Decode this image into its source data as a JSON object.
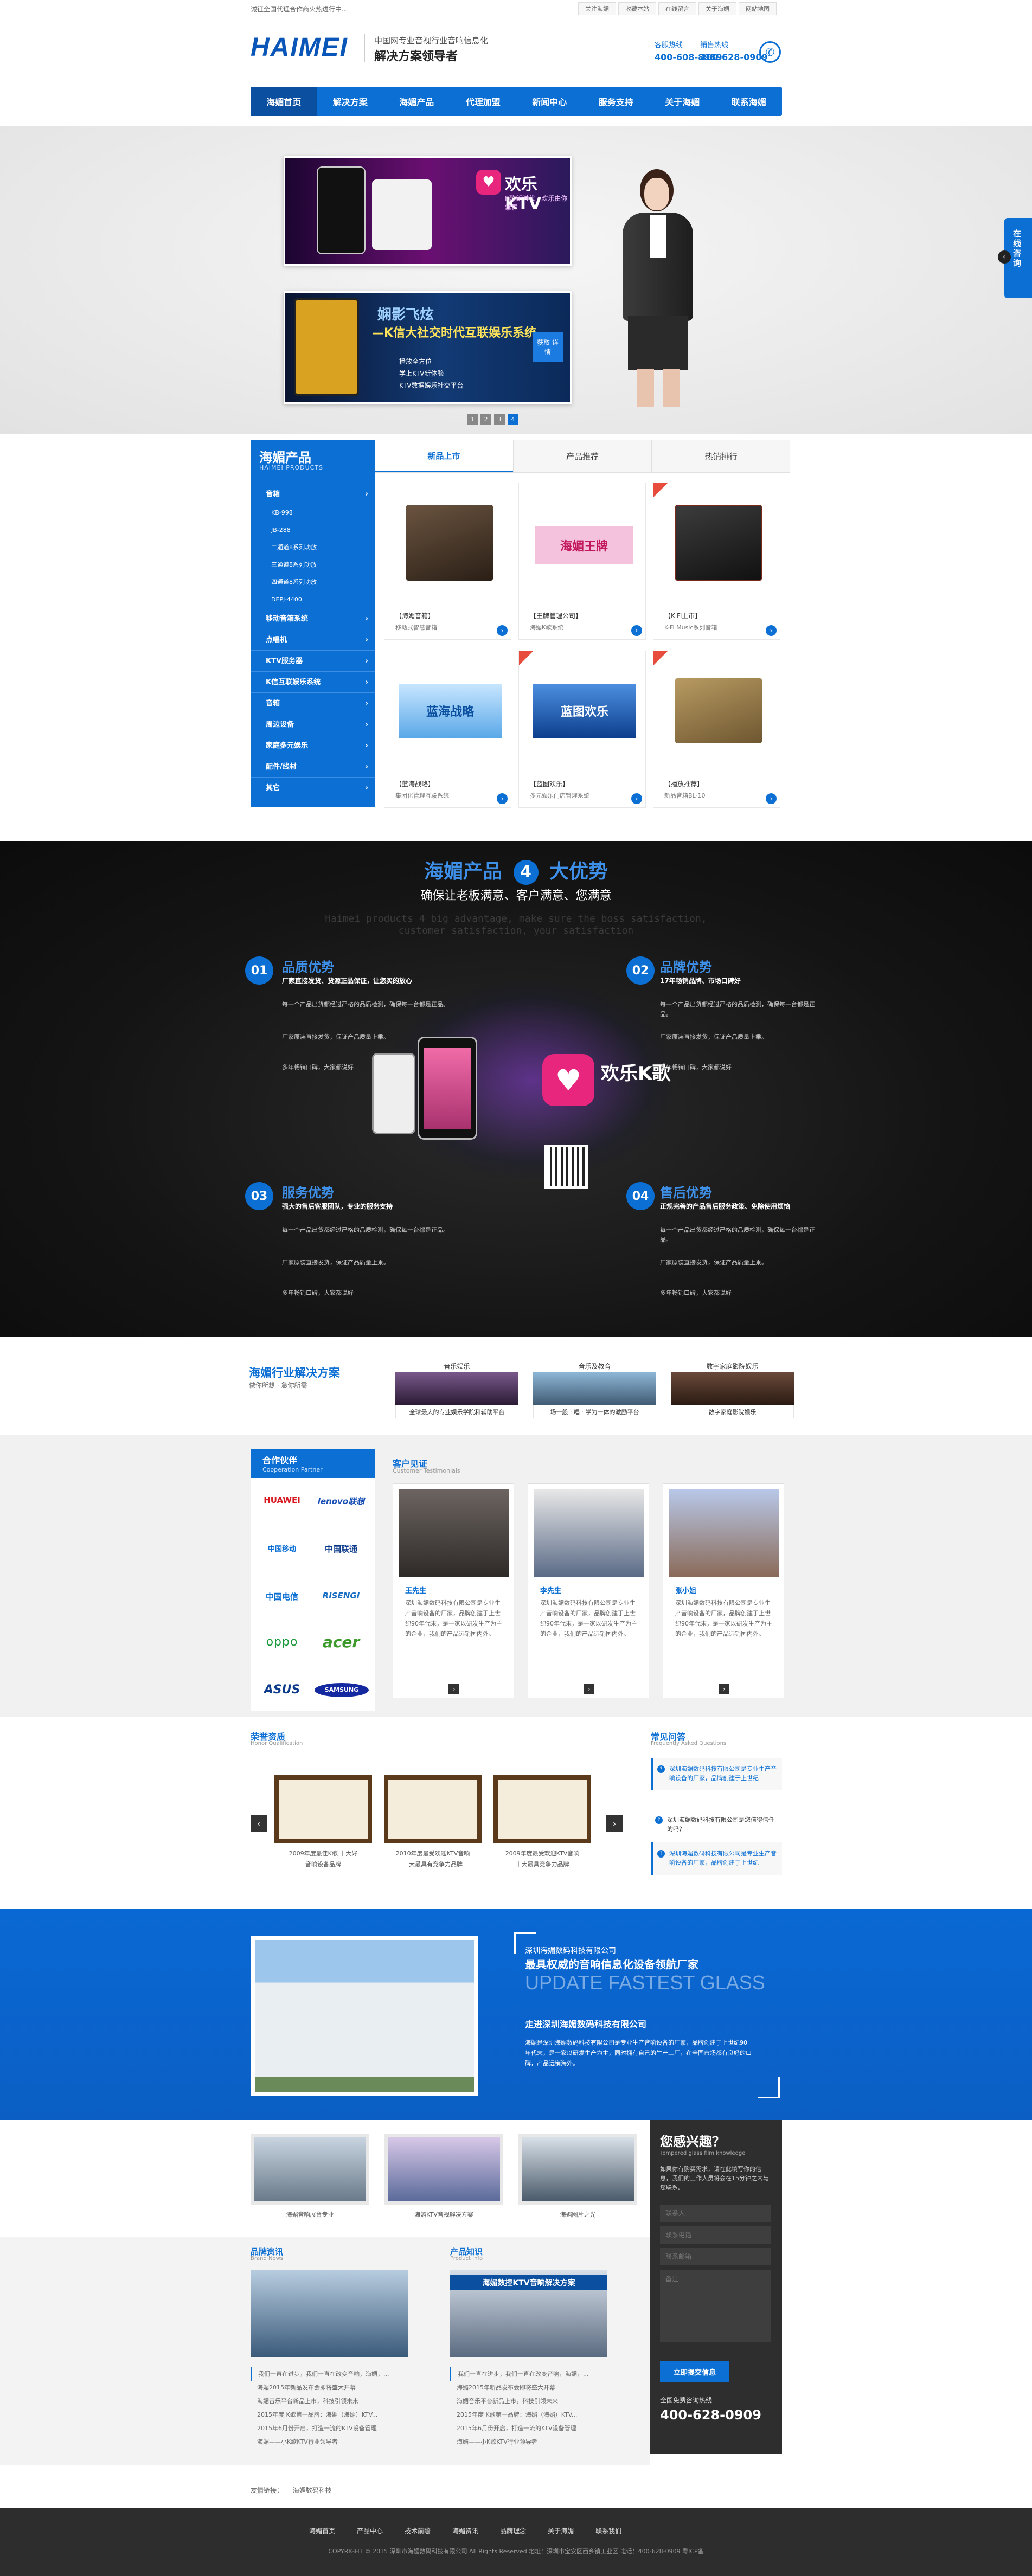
{
  "colors": {
    "accent": "#0b6fd3",
    "navy": "#0a4fa0",
    "dark": "#171717",
    "footer": "#2d2d2d"
  },
  "topbar": {
    "welcome": "诚征全国代理合作商火热进行中...",
    "links": [
      "关注海媚",
      "收藏本站",
      "在线留言",
      "关于海媚",
      "网站地图"
    ]
  },
  "header": {
    "logo": "HAIMEI",
    "slogan_line1": "中国网专业音视行业音响信息化",
    "slogan_line2": "解决方案领导者",
    "hotline_label1": "客服热线",
    "hotline_label2": "销售热线",
    "hotline1": "400-608-8989",
    "hotline2": "400-628-0909",
    "phone_icon": "phone-icon"
  },
  "nav": {
    "items": [
      "海媚首页",
      "解决方案",
      "海媚产品",
      "代理加盟",
      "新闻中心",
      "服务支持",
      "关于海媚",
      "联系海媚"
    ]
  },
  "banner": {
    "ad1_title": "欢乐KTV",
    "ad1_sub": "K歌新时代 · 欢乐由你掌握",
    "ad2_line1": "娴影飞炫",
    "ad2_line2": "—K信大社交时代互联娱乐系统",
    "ad2_b1": "播放全方位",
    "ad2_b2": "学上KTV新体验",
    "ad2_b3": "KTV数据娱乐社交平台",
    "ad2_btn": "获取 详情",
    "dots": [
      "1",
      "2",
      "3",
      "4"
    ],
    "active_dot": 3
  },
  "float_service": {
    "label": "在线咨询"
  },
  "products": {
    "title": "海媚产品",
    "subtitle": "HAIMEI PRODUCTS",
    "cats": [
      {
        "label": "音箱",
        "bold": true
      },
      {
        "label": "KB-998",
        "bold": false
      },
      {
        "label": "JB-288",
        "bold": false
      },
      {
        "label": "二通道8系列功放",
        "bold": false
      },
      {
        "label": "三通道8系列功放",
        "bold": false
      },
      {
        "label": "四通道8系列功放",
        "bold": false
      },
      {
        "label": "DEPJ-4400",
        "bold": false
      },
      {
        "label": "移动音箱系统",
        "bold": true
      },
      {
        "label": "点唱机",
        "bold": true
      },
      {
        "label": "KTV服务器",
        "bold": true
      },
      {
        "label": "K信互联娱乐系统",
        "bold": true
      },
      {
        "label": "音箱",
        "bold": true
      },
      {
        "label": "周边设备",
        "bold": true
      },
      {
        "label": "家庭多元娱乐",
        "bold": true
      },
      {
        "label": "配件/线材",
        "bold": true
      },
      {
        "label": "其它",
        "bold": true
      }
    ],
    "tabs": [
      "新品上市",
      "产品推荐",
      "热销排行"
    ],
    "active_tab": 0,
    "items": [
      {
        "name": "【海媚音箱】",
        "desc": "移动式智慧音箱",
        "img": "speaker-brown",
        "hot": false
      },
      {
        "name": "【王牌管理公司】",
        "desc": "海媚K歌系统",
        "img": "king-banner",
        "hot": false
      },
      {
        "name": "【K-Fi上市】",
        "desc": "K-Fi Music系列音箱",
        "img": "speaker-dark",
        "hot": true
      },
      {
        "name": "【蓝海战略】",
        "desc": "集团化管理互联系统",
        "img": "blue-banner",
        "hot": false
      },
      {
        "name": "【蓝图欢乐】",
        "desc": "多元娱乐门店管理系统",
        "img": "blue2-banner",
        "hot": true
      },
      {
        "name": "【播放推荐】",
        "desc": "新品音箱BL-10",
        "img": "speaker-gold",
        "hot": true
      }
    ]
  },
  "advantages": {
    "title_a": "海媚产品",
    "num": "4",
    "title_b": "大优势",
    "subtitle": "确保让老板满意、客户满意、您满意",
    "en_line1": "Haimei products 4 big advantage, make sure the boss satisfaction,",
    "en_line2": "customer satisfaction, your satisfaction",
    "items": [
      {
        "num": "01",
        "title": "品质优势",
        "sub": "厂家直接发货、货源正品保证，让您买的放心",
        "p1": "每一个产品出货都经过严格的品质检测，确保每一台都是正品。",
        "p2": "厂家原装直接发货，保证产品质量上乘。",
        "p3": "多年畅销口碑，大家都说好"
      },
      {
        "num": "02",
        "title": "品牌优势",
        "sub": "17年畅销品牌、市场口碑好",
        "p1": "每一个产品出货都经过严格的品质检测，确保每一台都是正品。",
        "p2": "厂家原装直接发货，保证产品质量上乘。",
        "p3": "多年畅销口碑，大家都说好"
      },
      {
        "num": "03",
        "title": "服务优势",
        "sub": "强大的售后客服团队，专业的服务支持",
        "p1": "每一个产品出货都经过严格的品质检测，确保每一台都是正品。",
        "p2": "厂家原装直接发货，保证产品质量上乘。",
        "p3": "多年畅销口碑，大家都说好"
      },
      {
        "num": "04",
        "title": "售后优势",
        "sub": "正规完善的产品售后服务政策、免除使用烦恼",
        "p1": "每一个产品出货都经过严格的品质检测，确保每一台都是正品。",
        "p2": "厂家原装直接发货，保证产品质量上乘。",
        "p3": "多年畅销口碑，大家都说好"
      }
    ],
    "phone_app": "欢乐K歌"
  },
  "solutions": {
    "title": "海媚行业解决方案",
    "sub": "做你所想 · 急你所需",
    "cards": [
      {
        "label": "音乐娱乐",
        "caption": "全球最大的专业娱乐学院和辅助平台"
      },
      {
        "label": "音乐及教育",
        "caption": "场一般 · 唱 · 学为一体的激励平台"
      },
      {
        "label": "数字家庭影院娱乐",
        "caption": "数字家庭影院娱乐"
      }
    ]
  },
  "partners": {
    "title": "合作伙伴",
    "sub": "Cooperation Partner",
    "logos": [
      "HUAWEI",
      "lenovo联想",
      "中国移动",
      "中国联通",
      "中国电信",
      "RISENGI",
      "oppo",
      "acer",
      "ASUS",
      "SAMSUNG"
    ]
  },
  "testimonials": {
    "title": "客户见证",
    "sub": "Customer Testimonials",
    "people": [
      {
        "name": "王先生",
        "text": "深圳海媚数码科技有限公司是专业生产音响设备的厂家，品牌创建于上世纪90年代末，是一家以研发生产为主的企业，我们的产品远销国内外。"
      },
      {
        "name": "李先生",
        "text": "深圳海媚数码科技有限公司是专业生产音响设备的厂家，品牌创建于上世纪90年代末，是一家以研发生产为主的企业，我们的产品远销国内外。"
      },
      {
        "name": "张小姐",
        "text": "深圳海媚数码科技有限公司是专业生产音响设备的厂家，品牌创建于上世纪90年代末，是一家以研发生产为主的企业，我们的产品远销国内外。"
      }
    ]
  },
  "honors": {
    "title": "荣誉资质",
    "sub": "Honor Qualification",
    "items": [
      {
        "cap1": "2009年度最佳K歌 十大好",
        "cap2": "音响设备品牌"
      },
      {
        "cap1": "2010年度最受欢迎KTV音响",
        "cap2": "十大最具有竞争力品牌"
      },
      {
        "cap1": "2009年度最受欢迎KTV音响",
        "cap2": "十大最具竞争力品牌"
      }
    ]
  },
  "faq": {
    "title": "常见问答",
    "sub": "Frequently Asked Questions",
    "items": [
      "深圳海媚数码科技有限公司是专业生产音响设备的厂家，品牌创建于上世纪",
      "深圳海媚数码科技有限公司是您值得信任的吗？",
      "深圳海媚数码科技有限公司是专业生产音响设备的厂家，品牌创建于上世纪"
    ]
  },
  "company": {
    "name_small": "深圳海媚数码科技有限公司",
    "headline": "最具权威的音响信息化设备领航厂家",
    "en": "UPDATE FASTEST GLASS",
    "sub": "走进深圳海媚数码科技有限公司",
    "desc": "海媚是深圳海媚数码科技有限公司是专业生产音响设备的厂家，品牌创建于上世纪90年代末，是一家以研发生产为主，同时拥有自己的生产工厂，在全国市场都有良好的口碑，产品远销海外。"
  },
  "gallery": {
    "items": [
      "海媚音响展台专业",
      "海媚KTV音视解决方案",
      "海媚图片之光"
    ]
  },
  "contact": {
    "title": "您感兴趣？",
    "sub": "Tempered glass film knowledge",
    "desc": "如果你有购买需求，请在此填写你的信息，我们的工作人员将会在15分钟之内与您联系。",
    "f1": "联系人",
    "f2": "联系电话",
    "f3": "联系邮箱",
    "f4": "备注",
    "submit": "立即提交信息",
    "hotline_label": "全国免费咨询热线",
    "hotline": "400-628-0909"
  },
  "news": {
    "brand": {
      "title": "品牌资讯",
      "sub": "Brand News",
      "list": [
        "我们一直在进步，我们一直在改变音响，海媚，...",
        "海媚2015年新品发布会即将盛大开幕",
        "海媚音乐平台新品上市，科技引领未来",
        "2015年度 K歌第一品牌：海媚（海媚）KTV...",
        "2015年6月份开启，打造一流的KTV设备管理",
        "海媚——小K歌KTV行业领导者"
      ]
    },
    "product": {
      "title": "产品知识",
      "sub": "Product Info",
      "banner": "海媚数控KTV音响解决方案",
      "list": [
        "我们一直在进步，我们一直在改变音响，海媚，...",
        "海媚2015年新品发布会即将盛大开幕",
        "海媚音乐平台新品上市，科技引领未来",
        "2015年度 K歌第一品牌：海媚（海媚）KTV...",
        "2015年6月份开启，打造一流的KTV设备管理",
        "海媚——小K歌KTV行业领导者"
      ]
    }
  },
  "links": {
    "label": "友情链接：",
    "items": [
      "海媚数码科技"
    ]
  },
  "footer": {
    "nav": [
      "海媚首页",
      "产品中心",
      "技术前瞻",
      "海媚资讯",
      "品牌理念",
      "关于海媚",
      "联系我们"
    ],
    "copyright": "COPYRIGHT © 2015 深圳市海媚数码科技有限公司 All Rights Reserved  地址：深圳市宝安区西乡镇工业区 电话：400-628-0909  粤ICP备"
  }
}
